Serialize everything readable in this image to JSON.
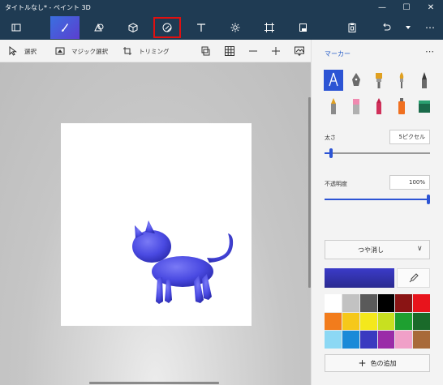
{
  "window": {
    "title": "タイトルなし* - ペイント 3D",
    "min_glyph": "—",
    "max_glyph": "☐",
    "close_glyph": "✕"
  },
  "toolbar": {
    "tools": [
      {
        "icon": "folder-menu-icon"
      },
      {
        "icon": "brush-icon",
        "active": true
      },
      {
        "icon": "2d-shapes-icon"
      },
      {
        "icon": "3d-shapes-icon"
      },
      {
        "icon": "stickers-icon",
        "highlighted": true
      },
      {
        "icon": "text-icon"
      },
      {
        "icon": "effects-icon"
      },
      {
        "icon": "canvas-icon"
      },
      {
        "icon": "remix-3d-icon"
      },
      {
        "icon": "paste-icon"
      },
      {
        "icon": "undo-icon"
      },
      {
        "icon": "chevron-down-icon"
      },
      {
        "icon": "more-icon"
      }
    ],
    "more_glyph": "⋯"
  },
  "subbar": {
    "select_label": "選択",
    "magic_select_label": "マジック選択",
    "crop_label": "トリミング"
  },
  "panel": {
    "title": "マーカー",
    "more_glyph": "⋯",
    "brushes_row1": [
      "marker-icon",
      "calligraphy-pen-icon",
      "oil-brush-icon",
      "watercolor-icon",
      "pixel-pen-icon"
    ],
    "brushes_row2": [
      "pencil-icon",
      "eraser-icon",
      "crayon-icon",
      "spray-can-icon",
      "fill-icon"
    ],
    "thickness_label": "太さ",
    "thickness_value": "5ピクセル",
    "thickness_level": 0.05,
    "opacity_label": "不透明度",
    "opacity_value": "100%",
    "opacity_level": 1.0,
    "finish_label": "つや消し",
    "current_color": "#3b3bc8",
    "palette": [
      "#ffffff",
      "#c2c2c2",
      "#5a5a5a",
      "#000000",
      "#8a1414",
      "#e8141c",
      "#f27c1c",
      "#f6c81a",
      "#f4e81c",
      "#c8e020",
      "#1ea030",
      "#1a6a2a",
      "#8cd8f4",
      "#1a8ad8",
      "#3a3ac0",
      "#9a2ca8",
      "#f0a0c8",
      "#a86a3a"
    ],
    "add_color_label": "色の追加"
  }
}
